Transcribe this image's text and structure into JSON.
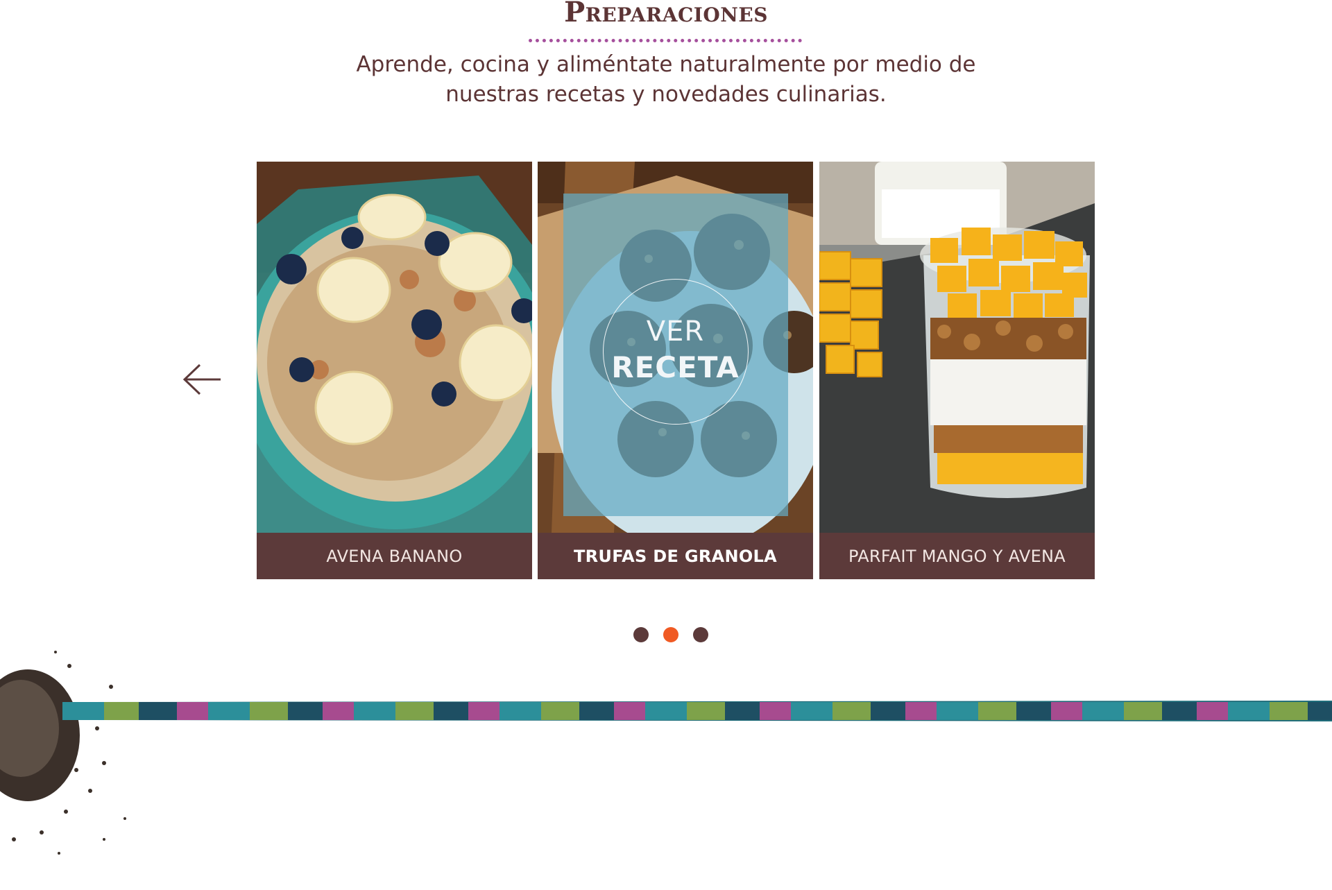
{
  "header": {
    "title": "Preparaciones",
    "subtitle": "Aprende, cocina y aliméntate naturalmente por medio de nuestras recetas y novedades culinarias."
  },
  "carousel": {
    "prev_icon": "arrow-left-icon",
    "cards": [
      {
        "label": "AVENA BANANO",
        "image": "oatmeal-banana-bowl-image"
      },
      {
        "label": "TRUFAS DE GRANOLA",
        "image": "granola-truffles-image",
        "overlay": {
          "line1": "VER",
          "line2": "RECETA"
        }
      },
      {
        "label": "PARFAIT MANGO Y AVENA",
        "image": "mango-parfait-image"
      }
    ],
    "pagination": {
      "count": 3,
      "active_index": 1
    }
  },
  "colors": {
    "brand_brown": "#5c3a3a",
    "accent_orange": "#f05a23",
    "accent_purple": "#a54f9c",
    "overlay_blue": "#64aac3"
  }
}
